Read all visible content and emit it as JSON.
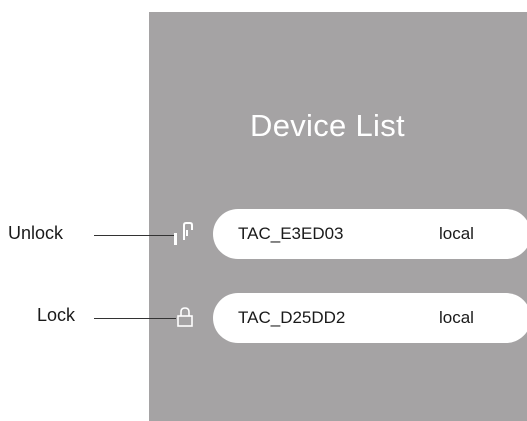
{
  "panel": {
    "title": "Device List",
    "background_color": "#a5a3a4"
  },
  "devices": [
    {
      "name": "TAC_E3ED03",
      "mode": "local",
      "lock_state": "unlocked",
      "icon": "unlock-icon"
    },
    {
      "name": "TAC_D25DD2",
      "mode": "local",
      "lock_state": "locked",
      "icon": "lock-icon"
    }
  ],
  "callouts": {
    "unlock": "Unlock",
    "lock": "Lock"
  }
}
